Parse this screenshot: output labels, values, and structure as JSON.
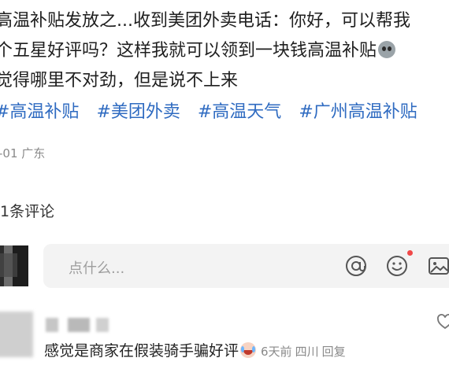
{
  "post": {
    "lines": [
      "高温补贴发放之...收到美团外卖电话：你好，可以帮我",
      "个五星好评吗？这样我就可以领到一块钱高温补贴",
      "觉得哪里不对劲，但是说不上来"
    ],
    "tags": [
      "#高温补贴",
      "#美团外卖",
      "#高温天气",
      "#广州高温补贴"
    ],
    "meta": "-01 广东"
  },
  "comments": {
    "count_label": "1条评论",
    "input_placeholder": "点什么...",
    "items": [
      {
        "text": "感觉是商家在假装骑手骗好评",
        "time": "6天前",
        "location": "四川",
        "reply_label": "回复"
      }
    ]
  },
  "icons": {
    "at": "at-icon",
    "emoji": "smile-icon",
    "image": "image-icon",
    "like": "heart-icon"
  },
  "colors": {
    "tag": "#2f6bc1",
    "meta": "#8a8a8a",
    "notify": "#f04848"
  }
}
